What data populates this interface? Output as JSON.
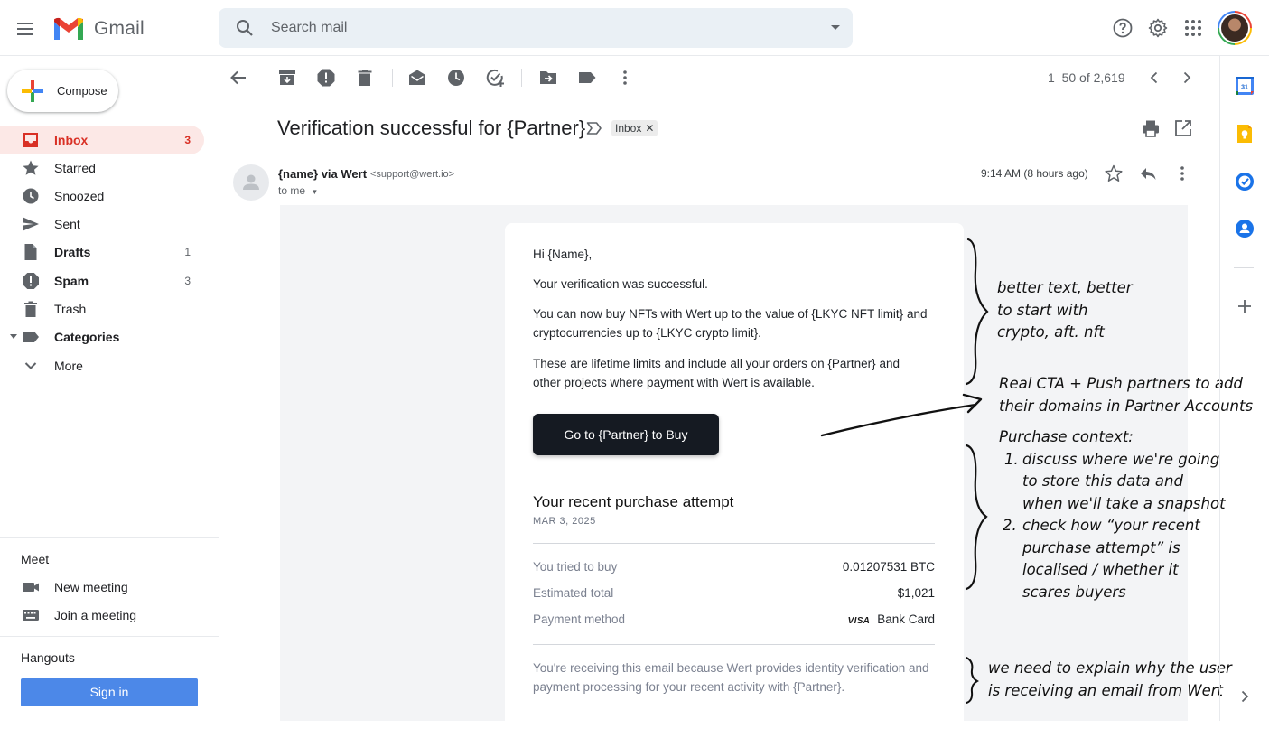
{
  "app": {
    "name": "Gmail"
  },
  "search": {
    "placeholder": "Search mail"
  },
  "compose": {
    "label": "Compose"
  },
  "sidebar": {
    "items": [
      {
        "label": "Inbox",
        "count": "3"
      },
      {
        "label": "Starred",
        "count": ""
      },
      {
        "label": "Snoozed",
        "count": ""
      },
      {
        "label": "Sent",
        "count": ""
      },
      {
        "label": "Drafts",
        "count": "1"
      },
      {
        "label": "Spam",
        "count": "3"
      },
      {
        "label": "Trash",
        "count": ""
      },
      {
        "label": "Categories",
        "count": ""
      },
      {
        "label": "More",
        "count": ""
      }
    ],
    "meet": {
      "title": "Meet",
      "new_meeting": "New meeting",
      "join_meeting": "Join a meeting"
    },
    "hangouts": {
      "title": "Hangouts",
      "sign_in": "Sign in"
    }
  },
  "toolbar": {
    "pager": "1–50 of 2,619"
  },
  "email": {
    "subject": "Verification successful for {Partner}",
    "label": "Inbox",
    "sender_name": "{name} via Wert",
    "sender_email": "<support@wert.io>",
    "to": "to me",
    "time": "9:14 AM (8 hours ago)",
    "body": {
      "greeting": "Hi {Name},",
      "p1": "Your verification was successful.",
      "p2": "You can now buy NFTs with Wert up to the value of {LKYC NFT limit} and cryptocurrencies up to {LKYC crypto limit}.",
      "p3": "These are lifetime limits and include all your orders on {Partner} and other projects where payment with Wert is available.",
      "cta": "Go to {Partner} to Buy",
      "purchase_title": "Your recent purchase attempt",
      "purchase_date": "MAR 3, 2025",
      "rows": [
        {
          "label": "You tried to buy",
          "value": "0.01207531 BTC"
        },
        {
          "label": "Estimated total",
          "value": "$1,021"
        },
        {
          "label": "Payment method",
          "brand": "VISA",
          "value": "Bank Card"
        }
      ],
      "footer": "You're receiving this email because Wert provides identity verification and payment processing for your recent activity with {Partner}."
    }
  },
  "annotations": {
    "note1": [
      "better text, better",
      "to start with",
      "crypto, aft. nft"
    ],
    "note2": [
      "Real CTA + Push partners to add",
      "their domains in Partner Accounts"
    ],
    "note3_title": "Purchase context:",
    "note3_items": [
      {
        "num": "1.",
        "lines": [
          "discuss where we're going",
          "to store this data and",
          "when we'll take a snapshot"
        ]
      },
      {
        "num": "2.",
        "lines": [
          "check how “your recent",
          "purchase attempt” is",
          "localised / whether it",
          "scares buyers"
        ]
      }
    ],
    "note4": [
      "we need to explain why the user",
      "is receiving an email from Wert"
    ]
  },
  "colors": {
    "accent_red": "#d93025",
    "active_bg": "#fce8e6",
    "signin_blue": "#4c88e8",
    "cta_dark": "#151a22"
  }
}
